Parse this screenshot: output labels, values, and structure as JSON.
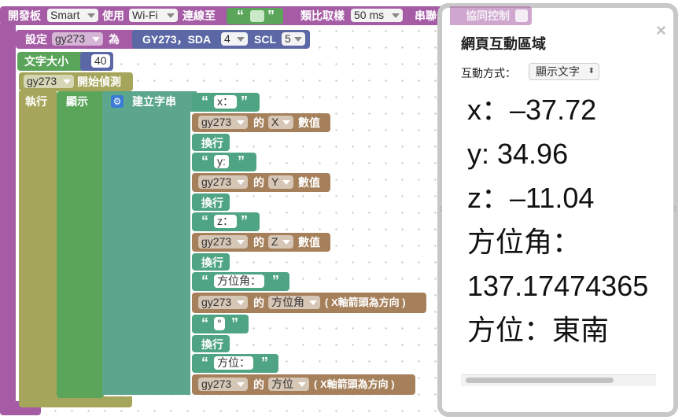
{
  "board_block": {
    "label": "開發板",
    "board": "Smart",
    "use_label": "使用",
    "conn": "Wi-Fi",
    "connect_label": "連線至",
    "device_id": "",
    "sample_label": "類比取樣",
    "sample_rate": "50 ms",
    "serial_label": "串聯",
    "collab_label": "協同控制"
  },
  "set_block": {
    "label": "設定",
    "var": "gy273",
    "as_label": "為",
    "sensor": "GY273，SDA",
    "sda": "4",
    "scl_label": "SCL",
    "scl": "5"
  },
  "font_block": {
    "label": "文字大小",
    "value": "40"
  },
  "detect_block": {
    "var": "gy273",
    "label": "開始偵測"
  },
  "exec_label": "執行",
  "show_label": "顯示",
  "build_string_label": "建立字串",
  "text_x": "x：",
  "text_y": "y:",
  "text_z": "z：",
  "text_azimuth_angle": "方位角：",
  "text_degree": "°",
  "text_direction": "方位：",
  "newline_label": "換行",
  "value_rows": [
    {
      "var": "gy273",
      "of": "的",
      "field": "X",
      "suffix": "數值"
    },
    {
      "var": "gy273",
      "of": "的",
      "field": "Y",
      "suffix": "數值"
    },
    {
      "var": "gy273",
      "of": "的",
      "field": "Z",
      "suffix": "數值"
    },
    {
      "var": "gy273",
      "of": "的",
      "field": "方位角",
      "suffix": "( X軸箭頭為方向 )"
    },
    {
      "var": "gy273",
      "of": "的",
      "field": "方位",
      "suffix": "( X軸箭頭為方向 )"
    }
  ],
  "panel": {
    "title": "網頁互動區域",
    "mode_label": "互動方式：",
    "mode_value": "顯示文字",
    "output_lines": [
      "x：–37.72",
      "y: 34.96",
      "z：–11.04",
      "方位角：",
      "137.17474365",
      "方位：東南"
    ]
  },
  "icons": {
    "close": "×",
    "gear": "gear-icon",
    "select_arrows": "⬍"
  },
  "colors": {
    "purple": "#a55ca5",
    "blue": "#5c68a6",
    "green": "#5ba55b",
    "olive": "#a5a55b",
    "teal": "#5ca68d",
    "brown": "#a5805b"
  }
}
